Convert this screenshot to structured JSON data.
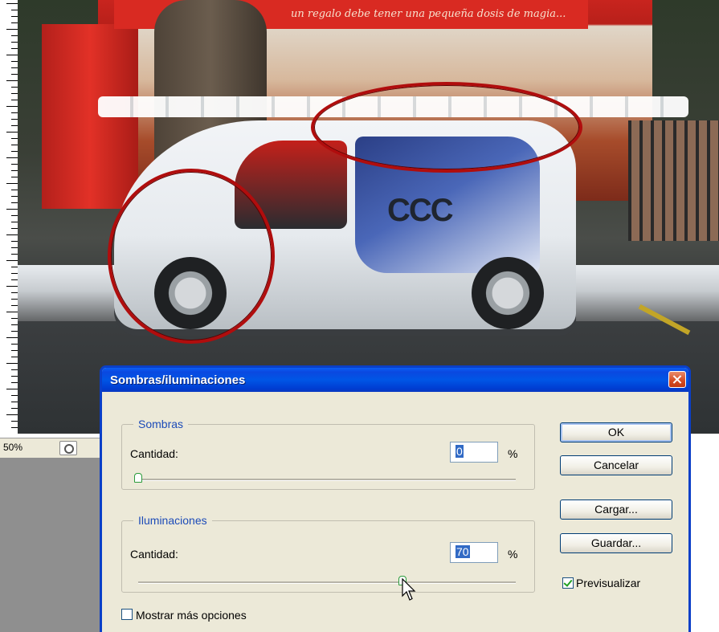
{
  "document": {
    "zoom": "50%",
    "image_text": "un regalo debe tener una pequeña dosis de magia...",
    "logo_text": "CCC"
  },
  "dialog": {
    "title": "Sombras/iluminaciones",
    "shadows": {
      "group_label": "Sombras",
      "amount_label": "Cantidad:",
      "amount_value": "0",
      "unit": "%",
      "slider_fraction": 0.0
    },
    "highlights": {
      "group_label": "Iluminaciones",
      "amount_label": "Cantidad:",
      "amount_value": "70",
      "unit": "%",
      "slider_fraction": 0.7
    },
    "buttons": {
      "ok": "OK",
      "cancel": "Cancelar",
      "load": "Cargar...",
      "save": "Guardar..."
    },
    "preview": {
      "label": "Previsualizar",
      "checked": true
    },
    "more_options": {
      "label": "Mostrar más opciones",
      "checked": false
    }
  },
  "colors": {
    "titlebar": "#0054e3",
    "group_label": "#1c4bb8",
    "dialog_bg": "#ece9d8",
    "annotation_ellipse": "#b00d0d"
  }
}
